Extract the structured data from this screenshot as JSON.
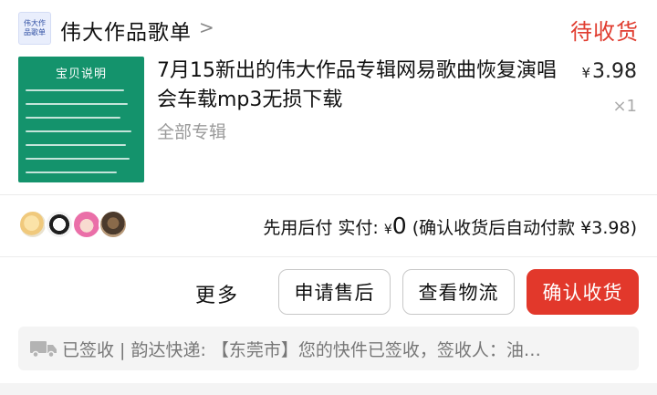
{
  "shop": {
    "logo_text": "伟大作品歌单",
    "name": "伟大作品歌单",
    "chevron": ">"
  },
  "order": {
    "status": "待收货"
  },
  "product": {
    "thumbnail_title": "宝贝说明",
    "title": "7月15新出的伟大作品专辑网易歌曲恢复演唱会车载mp3无损下载",
    "spec": "全部专辑",
    "price_symbol": "¥",
    "price": "3.98",
    "quantity": "×1"
  },
  "payment": {
    "label": "先用后付  实付: ",
    "currency": "¥",
    "amount": "0",
    "note": " (确认收货后自动付款 ¥3.98)"
  },
  "actions": {
    "more": "更多",
    "after_sale": "申请售后",
    "view_logistics": "查看物流",
    "confirm_receipt": "确认收货"
  },
  "logistics": {
    "text": "已签收 | 韵达快递: 【东莞市】您的快件已签收，签收人：油…"
  },
  "colors": {
    "accent_red": "#e2382b",
    "status_red": "#e03c2f",
    "thumbnail_green": "#14936c"
  },
  "icons": {
    "truck": "truck-icon",
    "chevron": "chevron-right-icon"
  }
}
